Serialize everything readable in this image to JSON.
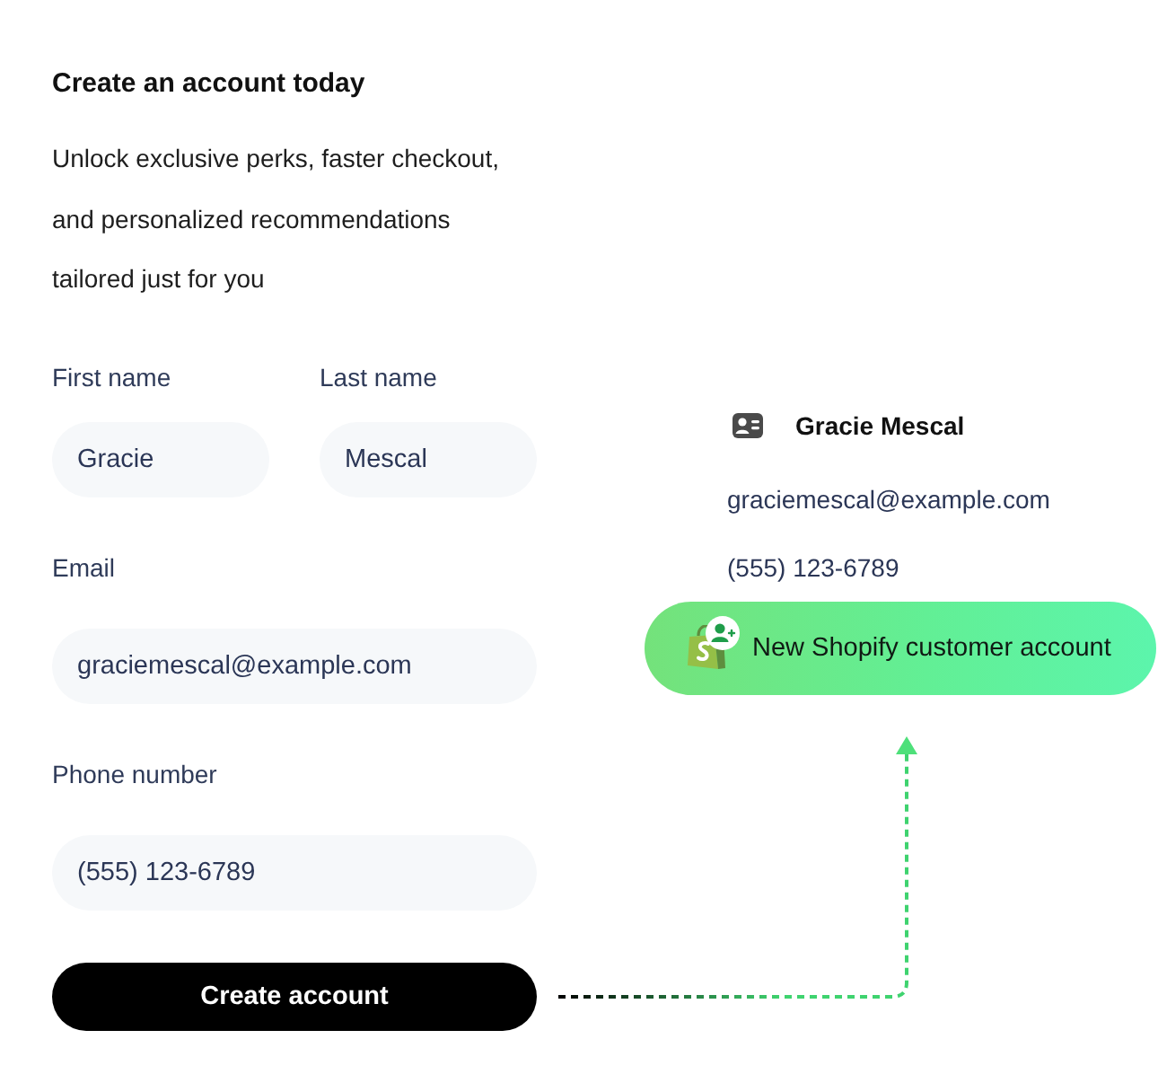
{
  "form": {
    "title": "Create an account today",
    "intro_lines": [
      "Unlock exclusive perks, faster checkout,",
      "and personalized recommendations",
      "tailored just for you"
    ],
    "name_fields": [
      {
        "label": "First name",
        "value": "Gracie"
      },
      {
        "label": "Last name",
        "value": "Mescal"
      }
    ],
    "fields": [
      {
        "label": "Email",
        "value": "graciemescal@example.com"
      },
      {
        "label": "Phone number",
        "value": "(555) 123-6789"
      }
    ],
    "submit": "Create account"
  },
  "contact": {
    "name": "Gracie Mescal",
    "email": "graciemescal@example.com",
    "phone": "(555) 123-6789"
  },
  "notification": {
    "text": "New Shopify customer account"
  }
}
